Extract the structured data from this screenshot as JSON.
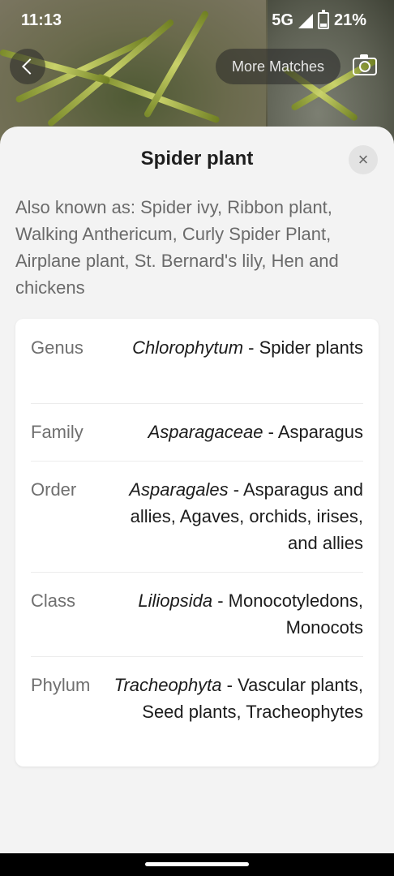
{
  "status": {
    "time": "11:13",
    "network": "5G",
    "battery": "21%"
  },
  "top_bar": {
    "more_matches_label": "More Matches"
  },
  "sheet": {
    "title": "Spider plant",
    "close_label": "×",
    "also_known_as": "Also known as: Spider ivy, Ribbon plant, Walking Anthericum, Curly Spider Plant, Airplane plant, St. Bernard's lily, Hen and chickens"
  },
  "taxonomy": [
    {
      "label": "Genus",
      "scientific": "Chlorophytum",
      "common": " - Spider plants"
    },
    {
      "label": "Family",
      "scientific": "Asparagaceae",
      "common": " - Asparagus"
    },
    {
      "label": "Order",
      "scientific": "Asparagales",
      "common": " - Asparagus and allies, Agaves, orchids, irises, and allies"
    },
    {
      "label": "Class",
      "scientific": "Liliopsida",
      "common": " - Monocotyledons, Monocots"
    },
    {
      "label": "Phylum",
      "scientific": "Tracheophyta",
      "common": " - Vascular plants, Seed plants, Tracheophytes"
    }
  ]
}
